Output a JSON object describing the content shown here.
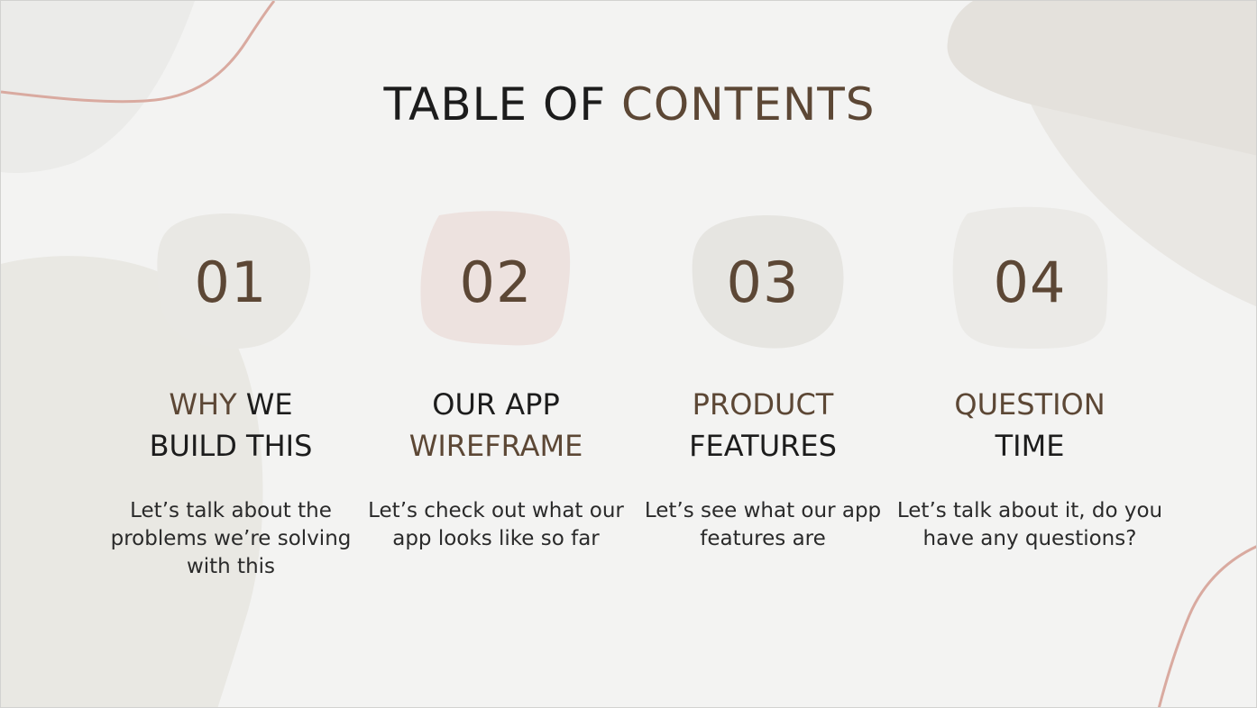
{
  "title": {
    "part1": "TABLE OF",
    "part2": "CONTENTS"
  },
  "colors": {
    "background": "#f3f3f2",
    "accent_brown": "#5c4735",
    "text_dark": "#1c1c1c",
    "line_pink": "#d9aaa0"
  },
  "items": [
    {
      "number": "01",
      "heading_line1_accent": "WHY",
      "heading_line1_dark": " WE",
      "heading_line2_accent": "",
      "heading_line2_dark": "BUILD THIS",
      "description": "Let’s talk about the problems we’re solving with this",
      "blob_color": "#e9e8e4"
    },
    {
      "number": "02",
      "heading_line1_accent": "",
      "heading_line1_dark": "OUR APP",
      "heading_line2_accent": "WIREFRAME",
      "heading_line2_dark": "",
      "description": "Let’s check out what our app looks like so far",
      "blob_color": "#ede2df"
    },
    {
      "number": "03",
      "heading_line1_accent": "PRODUCT",
      "heading_line1_dark": "",
      "heading_line2_accent": "",
      "heading_line2_dark": "FEATURES",
      "description": "Let’s see what our app features are",
      "blob_color": "#e6e5e1"
    },
    {
      "number": "04",
      "heading_line1_accent": "QUESTION",
      "heading_line1_dark": "",
      "heading_line2_accent": "",
      "heading_line2_dark": "TIME",
      "description": "Let’s talk about it, do you have any questions?",
      "blob_color": "#ebeae7"
    }
  ]
}
